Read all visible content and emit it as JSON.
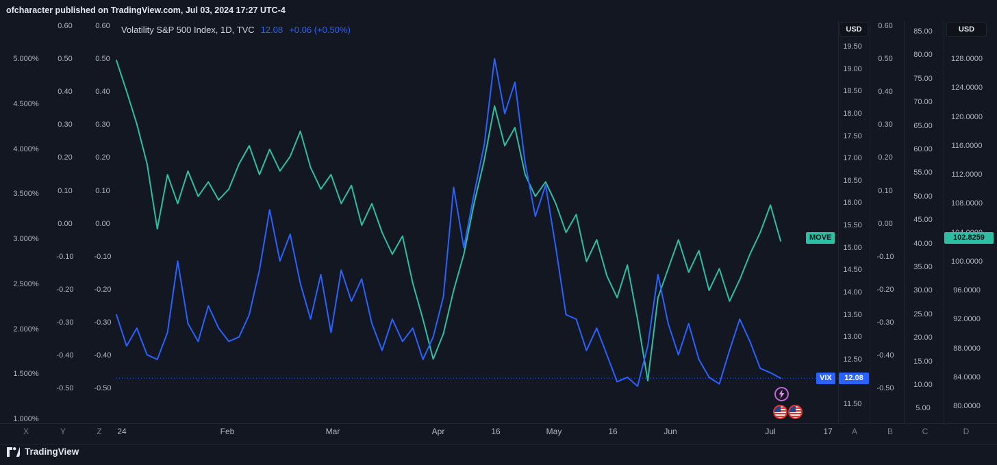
{
  "header": {
    "publish_line": "ofcharacter published on TradingView.com, Jul 03, 2024 17:27 UTC-4"
  },
  "legend": {
    "title": "Volatility S&P 500 Index, 1D, TVC",
    "value": "12.08",
    "change": "+0.06 (+0.50%)"
  },
  "colors": {
    "background": "#131722",
    "vix": "#2962ff",
    "move": "#2dbfa4",
    "axis_text": "#b2b5be",
    "muted_text": "#787b86"
  },
  "axes": {
    "percent_left": [
      "5.000%",
      "4.500%",
      "4.000%",
      "3.500%",
      "3.000%",
      "2.500%",
      "2.000%",
      "1.500%",
      "1.000%"
    ],
    "osc_left_1": [
      "0.60",
      "0.50",
      "0.40",
      "0.30",
      "0.20",
      "0.10",
      "0.00",
      "-0.10",
      "-0.20",
      "-0.30",
      "-0.40",
      "-0.50"
    ],
    "osc_left_2": [
      "0.60",
      "0.50",
      "0.40",
      "0.30",
      "0.20",
      "0.10",
      "0.00",
      "-0.10",
      "-0.20",
      "-0.30",
      "-0.40",
      "-0.50"
    ],
    "vix_right": {
      "currency": "USD",
      "ticks": [
        "19.50",
        "19.00",
        "18.50",
        "18.00",
        "17.50",
        "17.00",
        "16.50",
        "16.00",
        "15.50",
        "15.00",
        "14.50",
        "14.00",
        "13.50",
        "13.00",
        "12.50",
        "12.00",
        "11.50"
      ]
    },
    "osc_right": [
      "0.60",
      "0.50",
      "0.40",
      "0.30",
      "0.20",
      "0.10",
      "0.00",
      "-0.10",
      "-0.20",
      "-0.30",
      "-0.40",
      "-0.50"
    ],
    "scale_85": [
      "85.00",
      "80.00",
      "75.00",
      "70.00",
      "65.00",
      "60.00",
      "55.00",
      "50.00",
      "45.00",
      "40.00",
      "35.00",
      "30.00",
      "25.00",
      "20.00",
      "15.00",
      "10.00",
      "5.00"
    ],
    "move_right": {
      "currency": "USD",
      "ticks": [
        "128.0000",
        "124.0000",
        "120.0000",
        "116.0000",
        "112.0000",
        "108.0000",
        "104.0000",
        "100.0000",
        "96.0000",
        "92.0000",
        "88.0000",
        "84.0000",
        "80.0000"
      ]
    }
  },
  "time_axis": [
    "24",
    "Feb",
    "Mar",
    "Apr",
    "16",
    "May",
    "16",
    "Jun",
    "Jul",
    "17"
  ],
  "scale_keys_left": [
    "X",
    "Y",
    "Z"
  ],
  "scale_keys_right": [
    "A",
    "B",
    "C",
    "D"
  ],
  "price_labels": {
    "move": {
      "symbol": "MOVE",
      "value": "102.8259"
    },
    "vix": {
      "symbol": "VIX",
      "value": "12.08"
    }
  },
  "icons": {
    "event_lightning": "lightning-event-marker",
    "event_flags": "us-economic-event-markers"
  },
  "footer": {
    "brand": "TradingView"
  },
  "chart_data": {
    "type": "line",
    "title": "Volatility S&P 500 Index, 1D, TVC",
    "x_axis": {
      "labels": [
        "24",
        "Feb",
        "Mar",
        "Apr",
        "16",
        "May",
        "16",
        "Jun",
        "Jul",
        "17"
      ],
      "range": "Dec 24 - Jul 17",
      "grid": false
    },
    "legend_position": "top-left",
    "series": [
      {
        "name": "MOVE",
        "color": "#2dbfa4",
        "y_axis": {
          "min": 80,
          "max": 128,
          "unit": "USD"
        },
        "last": 102.8259,
        "values": [
          127.8,
          123.5,
          119.0,
          113.5,
          104.5,
          112.0,
          108.0,
          112.5,
          109.0,
          111.0,
          108.5,
          110.0,
          113.5,
          116.0,
          112.0,
          115.5,
          112.5,
          114.5,
          118.0,
          113.0,
          110.0,
          112.0,
          108.0,
          110.5,
          105.0,
          108.0,
          104.0,
          101.0,
          103.5,
          97.0,
          92.0,
          86.5,
          90.0,
          96.0,
          101.0,
          108.0,
          114.0,
          121.5,
          116.0,
          118.5,
          112.0,
          109.0,
          111.0,
          108.0,
          104.0,
          106.5,
          100.0,
          103.0,
          98.0,
          95.0,
          99.5,
          92.0,
          83.5,
          95.0,
          99.0,
          103.0,
          98.5,
          101.5,
          96.0,
          99.0,
          94.5,
          97.5,
          101.0,
          104.0,
          107.8,
          102.8259
        ]
      },
      {
        "name": "VIX",
        "color": "#2962ff",
        "y_axis": {
          "min": 11.5,
          "max": 19.5,
          "unit": "USD"
        },
        "last": 12.08,
        "values": [
          13.5,
          12.8,
          13.2,
          12.6,
          12.5,
          13.1,
          14.7,
          13.3,
          12.9,
          13.7,
          13.2,
          12.9,
          13.0,
          13.5,
          14.5,
          15.85,
          14.7,
          15.3,
          14.2,
          13.4,
          14.4,
          13.1,
          14.5,
          13.8,
          14.3,
          13.3,
          12.7,
          13.4,
          12.9,
          13.2,
          12.5,
          13.0,
          13.9,
          16.35,
          15.0,
          16.2,
          17.3,
          19.23,
          18.0,
          18.7,
          16.9,
          15.7,
          16.4,
          15.0,
          13.5,
          13.4,
          12.7,
          13.2,
          12.6,
          12.0,
          12.1,
          11.9,
          12.8,
          14.4,
          13.3,
          12.6,
          13.3,
          12.5,
          12.1,
          11.95,
          12.7,
          13.4,
          12.9,
          12.3,
          12.2,
          12.08
        ]
      }
    ]
  }
}
